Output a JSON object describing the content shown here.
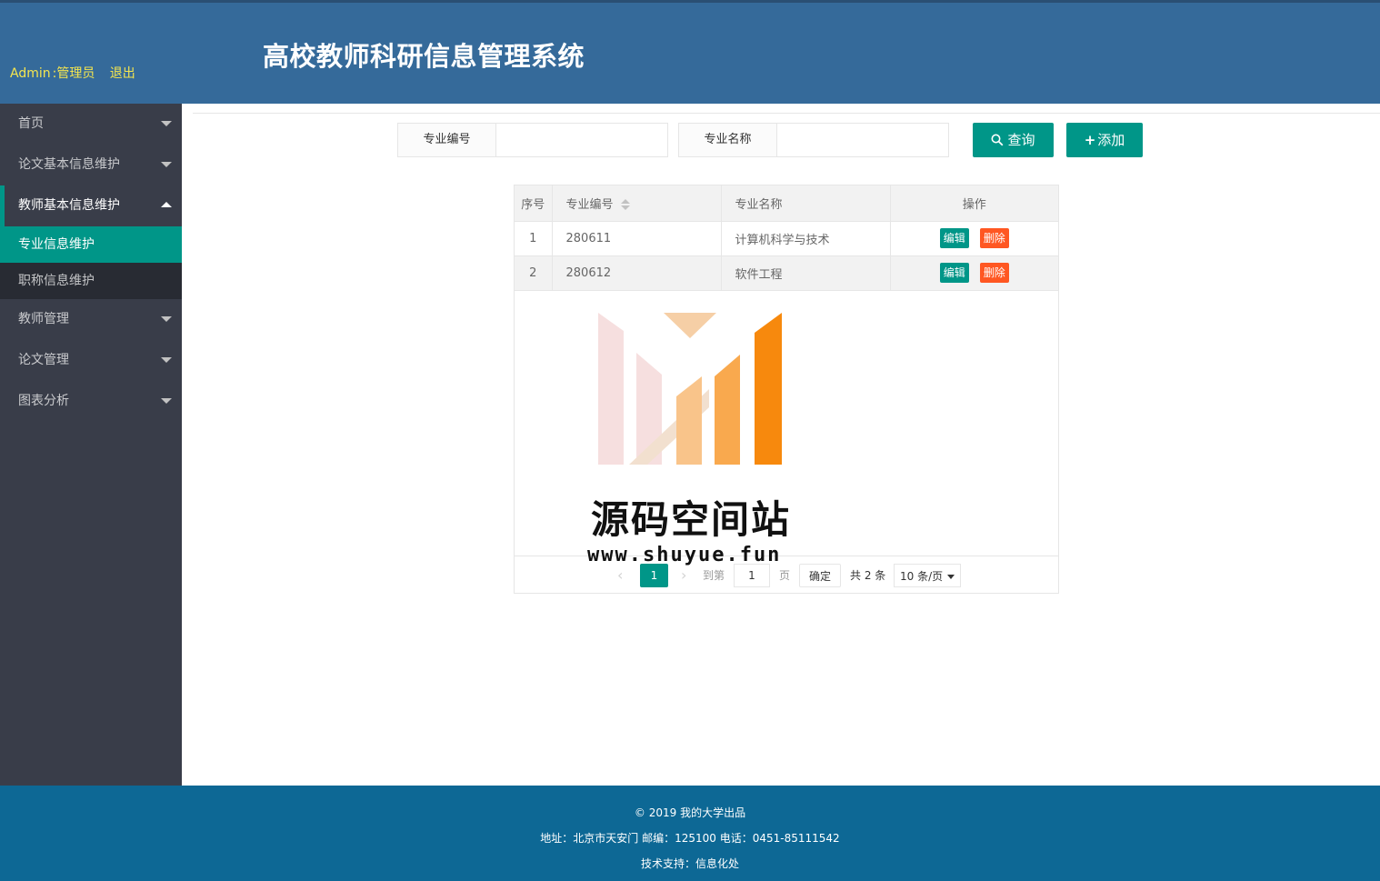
{
  "header": {
    "user_name": "Admin",
    "user_role": "管理员",
    "logout_label": "退出",
    "title": "高校教师科研信息管理系统"
  },
  "sidebar": {
    "items": [
      {
        "label": "首页"
      },
      {
        "label": "论文基本信息维护"
      },
      {
        "label": "教师基本信息维护",
        "sub_items": [
          {
            "label": "专业信息维护"
          },
          {
            "label": "职称信息维护"
          }
        ]
      },
      {
        "label": "教师管理"
      },
      {
        "label": "论文管理"
      },
      {
        "label": "图表分析"
      }
    ]
  },
  "search": {
    "code_label": "专业编号",
    "code_value": "",
    "name_label": "专业名称",
    "name_value": "",
    "query_label": "查询",
    "add_label": "添加"
  },
  "table": {
    "columns": [
      "序号",
      "专业编号",
      "专业名称",
      "操作"
    ],
    "rows": [
      {
        "seq": "1",
        "code": "280611",
        "name": "计算机科学与技术"
      },
      {
        "seq": "2",
        "code": "280612",
        "name": "软件工程"
      }
    ],
    "edit_label": "编辑",
    "delete_label": "删除"
  },
  "pager": {
    "current_page": "1",
    "goto_label": "到第",
    "goto_value": "1",
    "page_label": "页",
    "confirm_label": "确定",
    "total_label": "共 2 条",
    "page_size": "10 条/页"
  },
  "watermark": {
    "name": "源码空间站",
    "url": "www.shuyue.fun"
  },
  "footer": {
    "copyright": "© 2019 我的大学出品",
    "address": "地址：北京市天安门 邮编：125100 电话：0451-85111542",
    "support": "技术支持：信息化处"
  },
  "colors": {
    "header_bg": "#356a9a",
    "sidebar_bg": "#393d49",
    "accent": "#009688",
    "danger": "#ff5722",
    "footer_bg": "#0d6895",
    "user_text": "#f5e64f"
  }
}
